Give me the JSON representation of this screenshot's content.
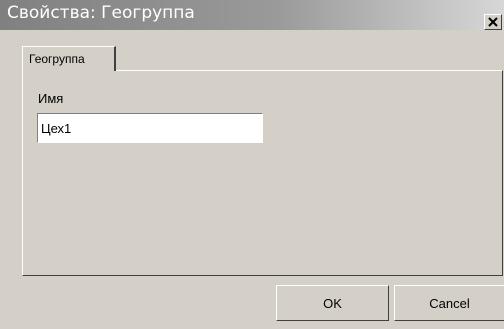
{
  "window": {
    "title": "Свойства: Геогруппа",
    "close_icon": "close-icon"
  },
  "tabs": [
    {
      "label": "Геогруппа",
      "selected": true
    }
  ],
  "form": {
    "name_label": "Имя",
    "name_value": "Цех1"
  },
  "buttons": {
    "ok_label": "OK",
    "cancel_label": "Cancel"
  },
  "colors": {
    "face": "#d4d0c8",
    "titlebar_start": "#808080",
    "titlebar_end": "#d7d7d7"
  }
}
